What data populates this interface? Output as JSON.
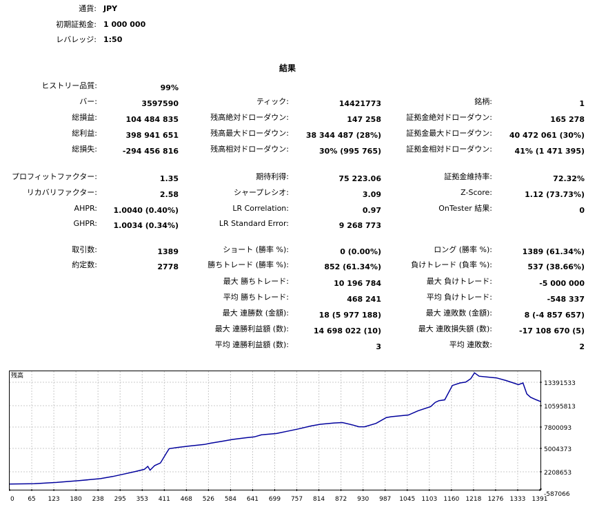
{
  "settings": {
    "currency_label": "通貨:",
    "currency_value": "JPY",
    "deposit_label": "初期証拠金:",
    "deposit_value": "1 000 000",
    "leverage_label": "レバレッジ:",
    "leverage_value": "1:50"
  },
  "results_title": "結果",
  "stats": {
    "history_quality": {
      "label": "ヒストリー品質:",
      "value": "99%"
    },
    "bars": {
      "label": "バー:",
      "value": "3597590"
    },
    "ticks": {
      "label": "ティック:",
      "value": "14421773"
    },
    "symbols": {
      "label": "銘柄:",
      "value": "1"
    },
    "net_profit": {
      "label": "総損益:",
      "value": "104 484 835"
    },
    "balance_dd_abs": {
      "label": "残高絶対ドローダウン:",
      "value": "147 258"
    },
    "equity_dd_abs": {
      "label": "証拠金絶対ドローダウン:",
      "value": "165 278"
    },
    "gross_profit": {
      "label": "総利益:",
      "value": "398 941 651"
    },
    "balance_dd_max": {
      "label": "残高最大ドローダウン:",
      "value": "38 344 487 (28%)"
    },
    "equity_dd_max": {
      "label": "証拠金最大ドローダウン:",
      "value": "40 472 061 (30%)"
    },
    "gross_loss": {
      "label": "総損失:",
      "value": "-294 456 816"
    },
    "balance_dd_rel": {
      "label": "残高相対ドローダウン:",
      "value": "30% (995 765)"
    },
    "equity_dd_rel": {
      "label": "証拠金相対ドローダウン:",
      "value": "41% (1 471 395)"
    },
    "profit_factor": {
      "label": "プロフィットファクター:",
      "value": "1.35"
    },
    "expected_payoff": {
      "label": "期待利得:",
      "value": "75 223.06"
    },
    "margin_level": {
      "label": "証拠金維持率:",
      "value": "72.32%"
    },
    "recovery_factor": {
      "label": "リカバリファクター:",
      "value": "2.58"
    },
    "sharpe_ratio": {
      "label": "シャープレシオ:",
      "value": "3.09"
    },
    "z_score": {
      "label": "Z-Score:",
      "value": "1.12 (73.73%)"
    },
    "ahpr": {
      "label": "AHPR:",
      "value": "1.0040 (0.40%)"
    },
    "lr_correlation": {
      "label": "LR Correlation:",
      "value": "0.97"
    },
    "ontester": {
      "label": "OnTester 結果:",
      "value": "0"
    },
    "ghpr": {
      "label": "GHPR:",
      "value": "1.0034 (0.34%)"
    },
    "lr_std_error": {
      "label": "LR Standard Error:",
      "value": "9 268 773"
    },
    "total_trades": {
      "label": "取引数:",
      "value": "1389"
    },
    "short_trades": {
      "label": "ショート (勝率 %):",
      "value": "0 (0.00%)"
    },
    "long_trades": {
      "label": "ロング (勝率 %):",
      "value": "1389 (61.34%)"
    },
    "total_deals": {
      "label": "約定数:",
      "value": "2778"
    },
    "profit_trades": {
      "label": "勝ちトレード (勝率 %):",
      "value": "852 (61.34%)"
    },
    "loss_trades": {
      "label": "負けトレード (負率 %):",
      "value": "537 (38.66%)"
    },
    "largest_profit": {
      "label": "最大 勝ちトレード:",
      "value": "10 196 784"
    },
    "largest_loss": {
      "label": "最大 負けトレード:",
      "value": "-5 000 000"
    },
    "avg_profit": {
      "label": "平均 勝ちトレード:",
      "value": "468 241"
    },
    "avg_loss": {
      "label": "平均 負けトレード:",
      "value": "-548 337"
    },
    "max_consec_wins": {
      "label": "最大 連勝数 (金額):",
      "value": "18 (5 977 188)"
    },
    "max_consec_losses": {
      "label": "最大 連敗数 (金額):",
      "value": "8 (-4 857 657)"
    },
    "max_consec_profit": {
      "label": "最大 連勝利益額 (数):",
      "value": "14 698 022 (10)"
    },
    "max_consec_loss": {
      "label": "最大 連敗損失額 (数):",
      "value": "-17 108 670 (5)"
    },
    "avg_consec_wins": {
      "label": "平均 連勝利益額 (数):",
      "value": "3"
    },
    "avg_consec_losses": {
      "label": "平均 連敗数:",
      "value": "2"
    }
  },
  "chart_data": {
    "type": "line",
    "title": "残高",
    "x_ticks": [
      "0",
      "65",
      "123",
      "180",
      "238",
      "295",
      "353",
      "411",
      "468",
      "526",
      "584",
      "641",
      "699",
      "757",
      "814",
      "872",
      "930",
      "987",
      "1045",
      "1103",
      "1160",
      "1218",
      "1276",
      "1333",
      "1391"
    ],
    "y_ticks": [
      "13391533",
      "10595813",
      "7800093",
      "5004373",
      "2208653",
      "-587066"
    ],
    "xlim": [
      0,
      1389
    ],
    "ylim": [
      -587066,
      13391533
    ],
    "grid": true,
    "series": [
      {
        "color": "#00009c",
        "x": [
          0,
          65,
          123,
          180,
          238,
          270,
          295,
          330,
          353,
          362,
          368,
          380,
          395,
          411,
          418,
          440,
          468,
          510,
          526,
          560,
          584,
          620,
          641,
          660,
          699,
          730,
          757,
          790,
          814,
          850,
          872,
          900,
          915,
          930,
          960,
          987,
          1000,
          1045,
          1070,
          1103,
          1115,
          1125,
          1140,
          1160,
          1180,
          1195,
          1208,
          1218,
          1230,
          1276,
          1300,
          1320,
          1333,
          1345,
          1355,
          1365,
          1380,
          1391
        ],
        "y": [
          0,
          50000,
          200000,
          400000,
          650000,
          900000,
          1150000,
          1500000,
          1750000,
          2100000,
          1650000,
          2200000,
          2500000,
          3700000,
          4200000,
          4350000,
          4500000,
          4700000,
          4850000,
          5100000,
          5300000,
          5500000,
          5600000,
          5850000,
          6000000,
          6300000,
          6550000,
          6900000,
          7100000,
          7250000,
          7300000,
          7000000,
          6800000,
          6800000,
          7200000,
          7900000,
          8000000,
          8200000,
          8700000,
          9200000,
          9700000,
          9900000,
          10000000,
          11700000,
          12000000,
          12100000,
          12500000,
          13200000,
          12800000,
          12600000,
          12300000,
          12000000,
          11800000,
          12000000,
          10700000,
          10300000,
          10000000,
          9800000
        ]
      }
    ]
  }
}
